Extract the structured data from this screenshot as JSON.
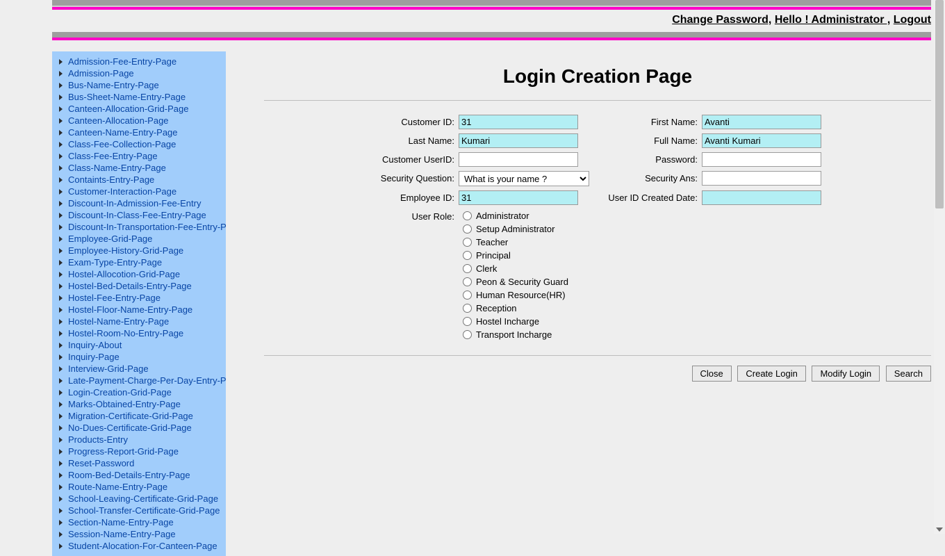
{
  "header": {
    "change_password": "Change Password,",
    "greeting": "Hello ! Administrator ,",
    "logout": "Logout"
  },
  "sidebar": {
    "items": [
      "Admission-Fee-Entry-Page",
      "Admission-Page",
      "Bus-Name-Entry-Page",
      "Bus-Sheet-Name-Entry-Page",
      "Canteen-Allocation-Grid-Page",
      "Canteen-Allocation-Page",
      "Canteen-Name-Entry-Page",
      "Class-Fee-Collection-Page",
      "Class-Fee-Entry-Page",
      "Class-Name-Entry-Page",
      "Containts-Entry-Page",
      "Customer-Interaction-Page",
      "Discount-In-Admission-Fee-Entry",
      "Discount-In-Class-Fee-Entry-Page",
      "Discount-In-Transportation-Fee-Entry-Page",
      "Employee-Grid-Page",
      "Employee-History-Grid-Page",
      "Exam-Type-Entry-Page",
      "Hostel-Allocotion-Grid-Page",
      "Hostel-Bed-Details-Entry-Page",
      "Hostel-Fee-Entry-Page",
      "Hostel-Floor-Name-Entry-Page",
      "Hostel-Name-Entry-Page",
      "Hostel-Room-No-Entry-Page",
      "Inquiry-About",
      "Inquiry-Page",
      "Interview-Grid-Page",
      "Late-Payment-Charge-Per-Day-Entry-Page",
      "Login-Creation-Grid-Page",
      "Marks-Obtained-Entry-Page",
      "Migration-Certificate-Grid-Page",
      "No-Dues-Certificate-Grid-Page",
      "Products-Entry",
      "Progress-Report-Grid-Page",
      "Reset-Password",
      "Room-Bed-Details-Entry-Page",
      "Route-Name-Entry-Page",
      "School-Leaving-Certificate-Grid-Page",
      "School-Transfer-Certificate-Grid-Page",
      "Section-Name-Entry-Page",
      "Session-Name-Entry-Page",
      "Student-Alocation-For-Canteen-Page"
    ]
  },
  "page": {
    "title": "Login Creation Page"
  },
  "form": {
    "labels": {
      "customer_id": "Customer ID:",
      "first_name": "First Name:",
      "last_name": "Last Name:",
      "full_name": "Full Name:",
      "customer_userid": "Customer UserID:",
      "password": "Password:",
      "security_question": "Security Question:",
      "security_ans": "Security Ans:",
      "employee_id": "Employee ID:",
      "created_date": "User ID Created Date:",
      "user_role": "User Role:"
    },
    "values": {
      "customer_id": "31",
      "first_name": "Avanti",
      "last_name": "Kumari",
      "full_name": "Avanti Kumari",
      "customer_userid": "",
      "password": "",
      "security_question": "What is your name ?",
      "security_ans": "",
      "employee_id": "31",
      "created_date": ""
    },
    "roles": [
      "Administrator",
      "Setup Administrator",
      "Teacher",
      "Principal",
      "Clerk",
      "Peon & Security Guard",
      "Human Resource(HR)",
      "Reception",
      "Hostel Incharge",
      "Transport Incharge"
    ]
  },
  "buttons": {
    "close": "Close",
    "create": "Create Login",
    "modify": "Modify Login",
    "search": "Search"
  }
}
